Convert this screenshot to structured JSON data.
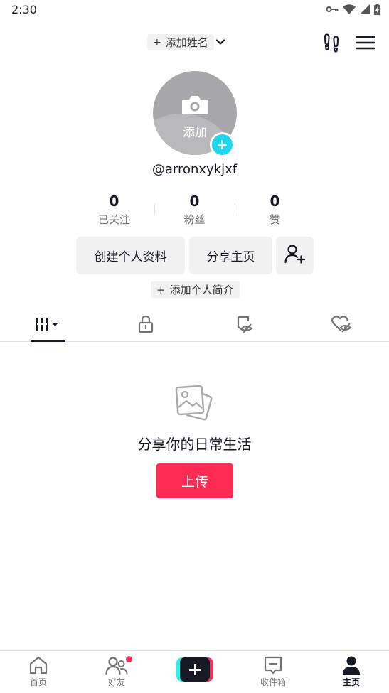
{
  "status_bar": {
    "time": "2:30",
    "icons": [
      "key-icon",
      "wifi-icon",
      "signal-icon",
      "battery-charging-icon"
    ]
  },
  "header": {
    "add_name_plus": "+",
    "add_name_label": "添加姓名",
    "icons": [
      "chevron-down-icon",
      "footprints-icon",
      "menu-icon"
    ]
  },
  "profile": {
    "avatar_label": "添加",
    "username": "@arronxykjxf",
    "stats": [
      {
        "value": "0",
        "label": "已关注"
      },
      {
        "value": "0",
        "label": "粉丝"
      },
      {
        "value": "0",
        "label": "赞"
      }
    ],
    "edit_profile_label": "创建个人资料",
    "share_profile_label": "分享主页",
    "add_bio_plus": "+",
    "add_bio_label": "添加个人简介"
  },
  "tabs": [
    {
      "name": "videos",
      "icon": "grid-icon",
      "active": true
    },
    {
      "name": "private",
      "icon": "lock-icon",
      "active": false
    },
    {
      "name": "favorites",
      "icon": "hidden-bookmark-icon",
      "active": false
    },
    {
      "name": "liked",
      "icon": "hidden-heart-icon",
      "active": false
    }
  ],
  "empty_state": {
    "icon": "photos-icon",
    "title": "分享你的日常生活",
    "upload_label": "上传"
  },
  "bottom_nav": [
    {
      "label": "首页",
      "icon": "home-icon"
    },
    {
      "label": "好友",
      "icon": "friends-icon",
      "badge": true
    },
    {
      "label": "",
      "icon": "create-plus-icon"
    },
    {
      "label": "收件箱",
      "icon": "inbox-icon"
    },
    {
      "label": "主页",
      "icon": "profile-icon",
      "active": true
    }
  ],
  "colors": {
    "accent": "#fe2c55",
    "cyan": "#20d5ec",
    "text": "#161823",
    "muted": "#737478",
    "chip_bg": "#f1f1f2"
  }
}
